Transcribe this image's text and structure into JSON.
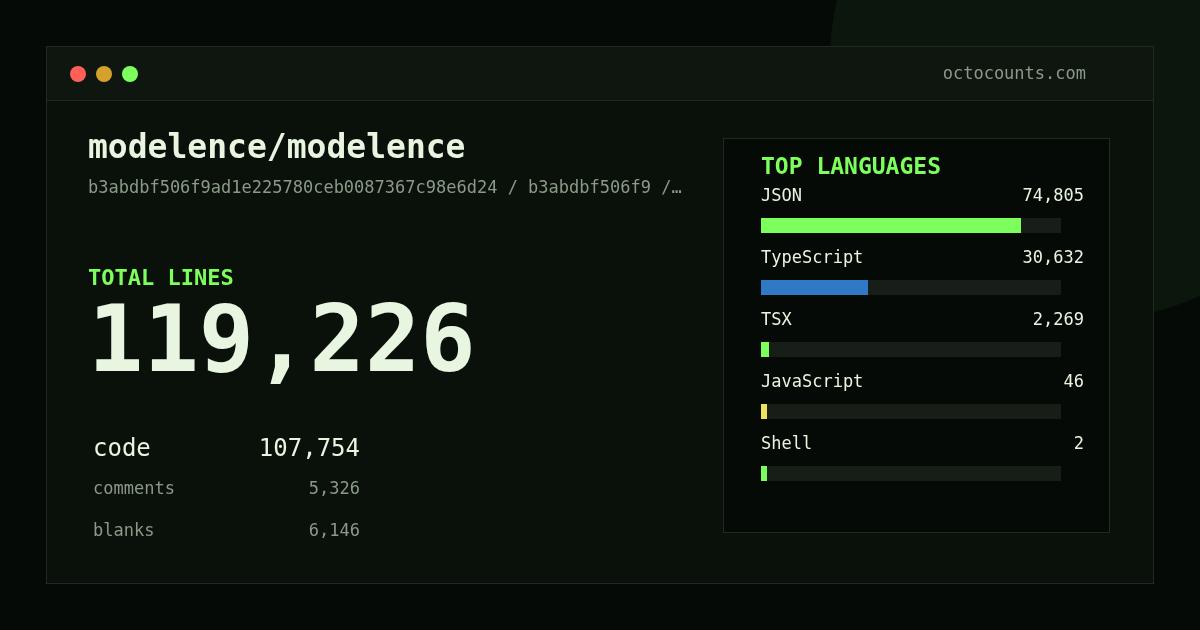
{
  "window": {
    "dots": [
      {
        "color": "#ff5f57"
      },
      {
        "color": "#d4a12a"
      },
      {
        "color": "#7cff5c"
      }
    ],
    "domain": "octocounts.com"
  },
  "repo": {
    "name": "modelence/modelence",
    "path": "b3abdbf506f9ad1e225780ceb0087367c98e6d24 / b3abdbf506f9 /…"
  },
  "total": {
    "label": "TOTAL LINES",
    "value": "119,226"
  },
  "stats": [
    {
      "kind": "primary",
      "label": "code",
      "value": "107,754"
    },
    {
      "kind": "secondary",
      "label": "comments",
      "value": "5,326"
    },
    {
      "kind": "secondary",
      "label": "blanks",
      "value": "6,146"
    }
  ],
  "languages": {
    "title": "TOP LANGUAGES",
    "items": [
      {
        "name": "JSON",
        "count": "74,805",
        "level": 0.867,
        "color": "#7cff5c"
      },
      {
        "name": "TypeScript",
        "count": "30,632",
        "level": 0.355,
        "color": "#3178c6"
      },
      {
        "name": "TSX",
        "count": "2,269",
        "level": 0.027,
        "color": "#7cff5c"
      },
      {
        "name": "JavaScript",
        "count": "46",
        "level": 0.02,
        "color": "#f1e05a"
      },
      {
        "name": "Shell",
        "count": "2",
        "level": 0.02,
        "color": "#7cff5c"
      }
    ]
  }
}
